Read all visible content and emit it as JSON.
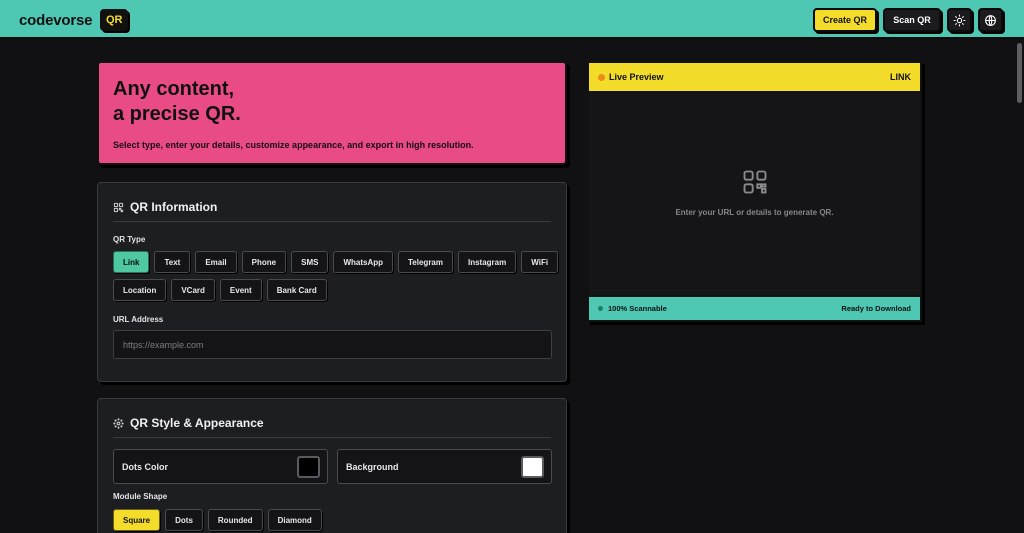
{
  "header": {
    "brand": "codevorse",
    "badge": "QR",
    "create_label": "Create QR",
    "scan_label": "Scan QR",
    "theme_icon": "sun-icon",
    "lang_icon": "globe-icon"
  },
  "hero": {
    "title_line1": "Any content,",
    "title_line2": "a precise QR.",
    "subtitle": "Select type, enter your details, customize appearance, and export in high resolution."
  },
  "info": {
    "title": "QR Information",
    "icon": "qr-grid-icon",
    "type_label": "QR Type",
    "types_row1": [
      "Link",
      "Text",
      "Email",
      "Phone",
      "SMS",
      "WhatsApp",
      "Telegram",
      "Instagram",
      "WiFi"
    ],
    "types_row2": [
      "Location",
      "VCard",
      "Event",
      "Bank Card"
    ],
    "active_type": "Link",
    "url_label": "URL Address",
    "url_placeholder": "https://example.com",
    "url_value": ""
  },
  "style": {
    "title": "QR Style & Appearance",
    "icon": "palette-icon",
    "dots_color_label": "Dots Color",
    "dots_color": "#000000",
    "background_label": "Background",
    "background_color": "#ffffff",
    "module_shape_label": "Module Shape",
    "shapes": [
      "Square",
      "Dots",
      "Rounded",
      "Diamond"
    ],
    "active_shape": "Square"
  },
  "preview": {
    "title": "Live Preview",
    "type": "LINK",
    "message": "Enter your URL or details to generate QR.",
    "footer_left": "100% Scannable",
    "footer_right": "Ready to Download"
  },
  "colors": {
    "teal": "#4ec7b3",
    "yellow": "#f3dc2a",
    "pink": "#e84b86",
    "dark": "#111113"
  }
}
